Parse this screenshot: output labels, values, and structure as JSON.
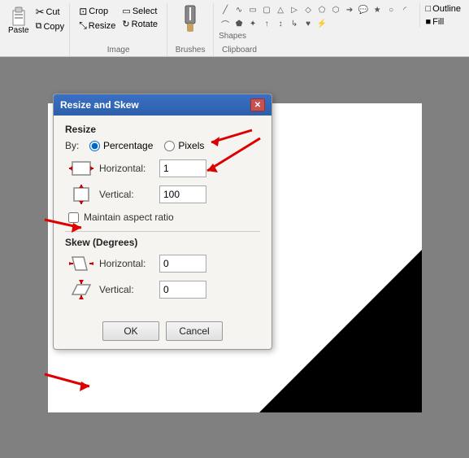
{
  "ribbon": {
    "clipboard_label": "Clipboard",
    "paste_label": "Paste",
    "cut_label": "Cut",
    "copy_label": "Copy",
    "image_label": "Image",
    "crop_label": "Crop",
    "resize_label": "Resize",
    "select_label": "Select",
    "rotate_label": "Rotate",
    "brushes_label": "Brushes",
    "shapes_label": "Shapes",
    "outline_label": "Outline",
    "fill_label": "Fill"
  },
  "dialog": {
    "title": "Resize and Skew",
    "close_btn": "✕",
    "resize_section": "Resize",
    "by_label": "By:",
    "percentage_label": "Percentage",
    "pixels_label": "Pixels",
    "horizontal_label": "Horizontal:",
    "vertical_label": "Vertical:",
    "horizontal_resize_value": "1",
    "vertical_resize_value": "100",
    "aspect_ratio_label": "Maintain aspect ratio",
    "skew_section": "Skew (Degrees)",
    "horizontal_skew_label": "Horizontal:",
    "vertical_skew_label": "Vertical:",
    "horizontal_skew_value": "0",
    "vertical_skew_value": "0",
    "ok_label": "OK",
    "cancel_label": "Cancel"
  },
  "canvas": {
    "background_color": "#808080",
    "canvas_color": "#ffffff"
  }
}
